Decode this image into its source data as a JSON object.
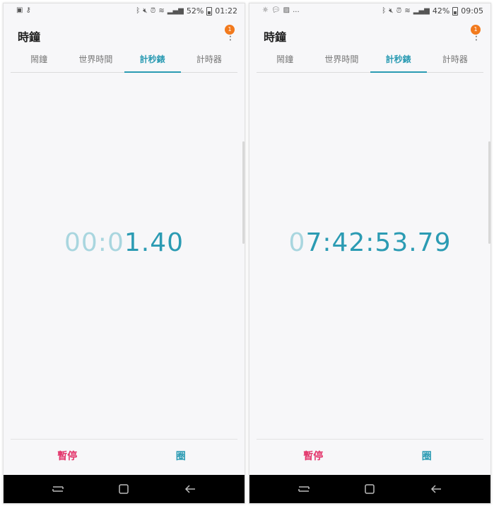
{
  "screens": [
    {
      "status": {
        "battery": "52%",
        "time": "01:22"
      },
      "app_title": "時鐘",
      "badge_count": "1",
      "tabs": [
        "鬧鐘",
        "世界時間",
        "計秒錶",
        "計時器"
      ],
      "active_tab": 2,
      "timer": {
        "dim": "00:0",
        "bright": "1.40"
      },
      "buttons": {
        "pause": "暫停",
        "lap": "圈"
      }
    },
    {
      "status": {
        "battery": "42%",
        "time": "09:05",
        "notif_more": "..."
      },
      "app_title": "時鐘",
      "badge_count": "1",
      "tabs": [
        "鬧鐘",
        "世界時間",
        "計秒錶",
        "計時器"
      ],
      "active_tab": 2,
      "timer": {
        "dim": "0",
        "bright": "7:42:53.79"
      },
      "buttons": {
        "pause": "暫停",
        "lap": "圈"
      }
    }
  ],
  "colors": {
    "accent": "#2b9bb3",
    "accent_dim": "#a9d6df",
    "pause": "#e3356b",
    "badge": "#f27a1d"
  },
  "icons": [
    "bluetooth-icon",
    "mute-icon",
    "alarm-icon",
    "wifi-icon",
    "signal-icon",
    "battery-icon",
    "menu-icon",
    "recent-apps-icon",
    "home-icon",
    "back-icon"
  ]
}
